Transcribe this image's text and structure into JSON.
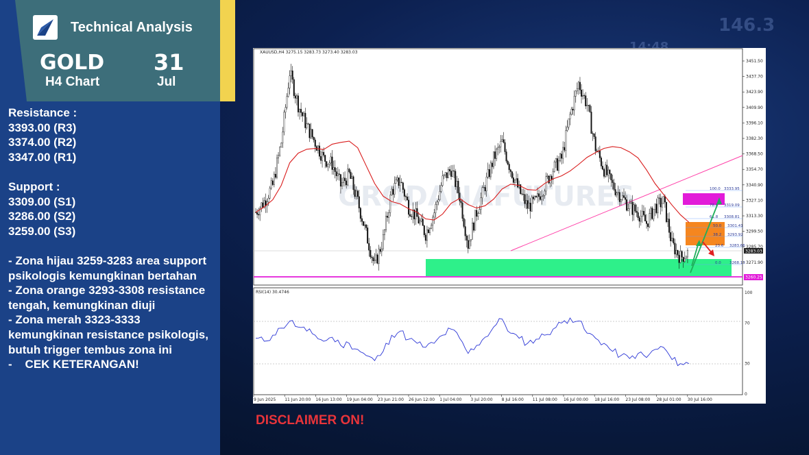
{
  "header": {
    "brand": "Technical Analysis",
    "asset": "GOLD",
    "timeframe": "H4 Chart",
    "day": "31",
    "month": "Jul"
  },
  "levels": {
    "resistance_title": "Resistance :",
    "resistance": [
      "3393.00 (R3)",
      "3374.00 (R2)",
      "3347.00 (R1)"
    ],
    "support_title": "Support :",
    "support": [
      "3309.00 (S1)",
      "3286.00 (S2)",
      "3259.00 (S3)"
    ]
  },
  "notes": [
    "- Zona hijau 3259-3283 area support psikologis kemungkinan bertahan",
    "- Zona orange 3293-3308 resistance tengah, kemungkinan diuji",
    "- Zona merah 3323-3333 kemungkinan resistance psikologis, butuh trigger tembus zona ini",
    "-    CEK KETERANGAN!"
  ],
  "disclaimer": "DISCLAIMER ON!",
  "chart": {
    "symbol_line": "XAUUSD,H4  3275.15 3283.73 3273.40 3283.03",
    "rsi_label": "RSI(14) 30.4746",
    "watermark": "GRODANAFUTURES",
    "price_ticks": [
      "3451.50",
      "3437.70",
      "3423.90",
      "3409.90",
      "3396.10",
      "3382.30",
      "3368.50",
      "3354.70",
      "3340.90",
      "3327.10",
      "3313.30",
      "3299.50",
      "3285.70",
      "3271.90"
    ],
    "current_price": "3283.03",
    "low_label": "3260.25",
    "rsi_ticks": [
      "100",
      "70",
      "30",
      "0"
    ],
    "time_ticks": [
      "9 Jun 2025",
      "11 Jun 20:00",
      "16 Jun 13:00",
      "19 Jun 04:00",
      "23 Jun 21:00",
      "26 Jun 12:00",
      "1 Jul 04:00",
      "3 Jul 20:00",
      "8 Jul 16:00",
      "11 Jul 08:00",
      "16 Jul 00:00",
      "18 Jul 16:00",
      "23 Jul 08:00",
      "28 Jul 01:00",
      "30 Jul 16:00"
    ],
    "fib_levels": [
      {
        "ratio": "100.0",
        "price": "3333.95"
      },
      {
        "ratio": "78.6",
        "price": "3319.09"
      },
      {
        "ratio": "61.8",
        "price": "3308.81"
      },
      {
        "ratio": "50.0",
        "price": "3301.41"
      },
      {
        "ratio": "38.2",
        "price": "3293.92"
      },
      {
        "ratio": "23.6",
        "price": "3283.66"
      },
      {
        "ratio": "0.0",
        "price": "3268.13"
      }
    ]
  },
  "colors": {
    "resistance_zone": "#e21bd9",
    "mid_zone": "#f5861f",
    "support_zone": "#2ef08a",
    "ma_line": "#d91c1c",
    "trendline": "#ff3fa8",
    "rsi_line": "#2a35d6"
  },
  "chart_data": {
    "type": "line",
    "title": "XAUUSD,H4",
    "series": [
      {
        "name": "XAUUSD,H4",
        "values": [
          3320,
          3330,
          3345,
          3385,
          3450,
          3420,
          3400,
          3385,
          3370,
          3365,
          3345,
          3355,
          3330,
          3300,
          3270,
          3295,
          3340,
          3350,
          3325,
          3315,
          3300,
          3320,
          3350,
          3360,
          3335,
          3290,
          3320,
          3345,
          3370,
          3385,
          3360,
          3340,
          3325,
          3330,
          3345,
          3360,
          3370,
          3410,
          3440,
          3420,
          3380,
          3360,
          3345,
          3335,
          3325,
          3320,
          3310,
          3325,
          3330,
          3290,
          3278,
          3283
        ]
      },
      {
        "name": "RSI(14) 30.4746",
        "values": [
          55,
          52,
          58,
          65,
          72,
          66,
          62,
          58,
          52,
          56,
          48,
          50,
          44,
          38,
          33,
          42,
          58,
          62,
          54,
          50,
          46,
          50,
          58,
          64,
          55,
          40,
          48,
          56,
          66,
          74,
          60,
          55,
          50,
          54,
          58,
          64,
          70,
          75,
          72,
          60,
          55,
          50,
          42,
          38,
          35,
          40,
          36,
          44,
          46,
          34,
          30,
          30
        ]
      }
    ],
    "ylim": [
      3260,
      3460
    ],
    "rsi_ylim": [
      0,
      100
    ]
  }
}
